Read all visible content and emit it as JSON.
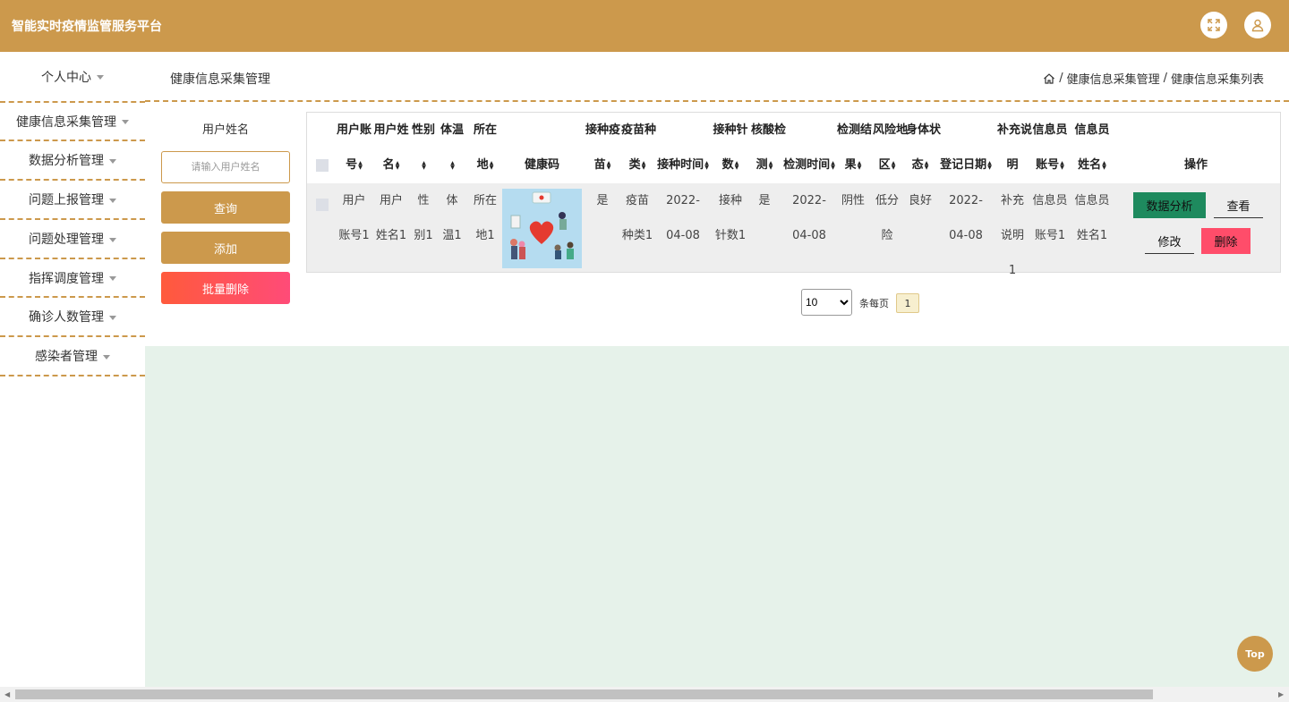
{
  "app": {
    "title": "智能实时疫情监管服务平台"
  },
  "header": {
    "fullscreen_icon": "expand-icon",
    "user_icon": "user-icon"
  },
  "sidebar": {
    "items": [
      {
        "label": "个人中心"
      },
      {
        "label": "健康信息采集管理"
      },
      {
        "label": "数据分析管理"
      },
      {
        "label": "问题上报管理"
      },
      {
        "label": "问题处理管理"
      },
      {
        "label": "指挥调度管理"
      },
      {
        "label": "确诊人数管理"
      },
      {
        "label": "感染者管理"
      }
    ]
  },
  "page": {
    "title": "健康信息采集管理",
    "breadcrumb": [
      "健康信息采集管理",
      "健康信息采集列表"
    ],
    "breadcrumb_separator": "/"
  },
  "search": {
    "label": "用户姓名",
    "placeholder": "请输入用户姓名",
    "query_button": "查询",
    "add_button": "添加",
    "batch_delete_button": "批量删除"
  },
  "table": {
    "headers": [
      {
        "l1": "用户账",
        "l2": "号"
      },
      {
        "l1": "用户姓",
        "l2": "名"
      },
      {
        "l1": "性别",
        "l2": ""
      },
      {
        "l1": "体温",
        "l2": ""
      },
      {
        "l1": "所在",
        "l2": "地"
      },
      {
        "l1": "",
        "l2": "健康码"
      },
      {
        "l1": "接种疫",
        "l2": "苗"
      },
      {
        "l1": "疫苗种",
        "l2": "类"
      },
      {
        "l1": "",
        "l2": "接种时间"
      },
      {
        "l1": "接种针",
        "l2": "数"
      },
      {
        "l1": "核酸检",
        "l2": "测"
      },
      {
        "l1": "",
        "l2": "检测时间"
      },
      {
        "l1": "检测结",
        "l2": "果"
      },
      {
        "l1": "风险地",
        "l2": "区"
      },
      {
        "l1": "身体状",
        "l2": "态"
      },
      {
        "l1": "",
        "l2": "登记日期"
      },
      {
        "l1": "补充说",
        "l2": "明"
      },
      {
        "l1": "信息员",
        "l2": "账号"
      },
      {
        "l1": "信息员",
        "l2": "姓名"
      },
      {
        "l1": "",
        "l2": "操作"
      }
    ],
    "rows": [
      {
        "cells": [
          {
            "l1": "用户",
            "l2": "账号1"
          },
          {
            "l1": "用户",
            "l2": "姓名1"
          },
          {
            "l1": "性",
            "l2": "别1"
          },
          {
            "l1": "体",
            "l2": "温1"
          },
          {
            "l1": "所在",
            "l2": "地1"
          },
          {
            "l1": "",
            "l2": ""
          },
          {
            "l1": "是",
            "l2": ""
          },
          {
            "l1": "疫苗",
            "l2": "种类1"
          },
          {
            "l1": "2022-",
            "l2": "04-08"
          },
          {
            "l1": "接种",
            "l2": "针数1"
          },
          {
            "l1": "是",
            "l2": ""
          },
          {
            "l1": "2022-",
            "l2": "04-08"
          },
          {
            "l1": "阴性",
            "l2": ""
          },
          {
            "l1": "低分",
            "l2": "险"
          },
          {
            "l1": "良好",
            "l2": ""
          },
          {
            "l1": "2022-",
            "l2": "04-08"
          },
          {
            "l1": "补充",
            "l2": "说明1"
          },
          {
            "l1": "信息员",
            "l2": "账号1"
          },
          {
            "l1": "信息员",
            "l2": "姓名1"
          }
        ],
        "actions": {
          "analyze": "数据分析",
          "view": "查看",
          "edit": "修改",
          "delete": "删除"
        }
      }
    ]
  },
  "pagination": {
    "page_size": "10",
    "page_size_options": [
      "10"
    ],
    "per_page_label": "条每页",
    "current_page": "1"
  },
  "back_to_top": "Top",
  "colors": {
    "accent": "#cc994c",
    "danger_gradient": [
      "#ff5a3c",
      "#ff4b78"
    ],
    "analyze": "#1e8a5e",
    "delete": "#ff4d6a",
    "content_bg": "#e6f2ea"
  }
}
